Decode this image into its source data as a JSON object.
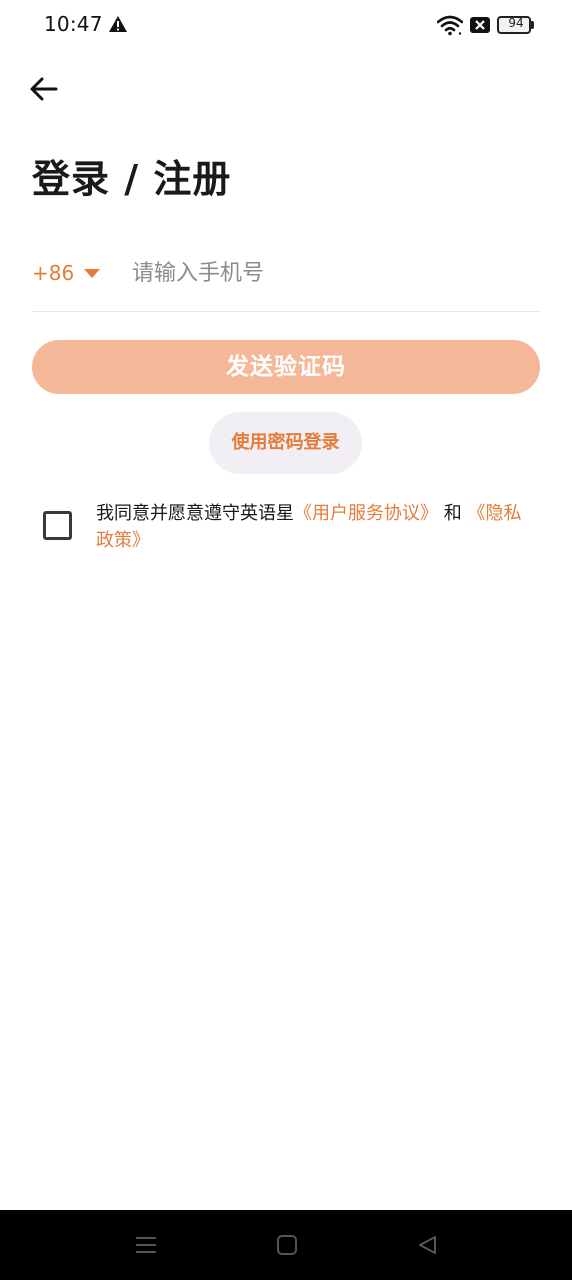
{
  "status_bar": {
    "time": "10:47",
    "battery_level": "94",
    "icons": [
      "warning-icon",
      "wifi-icon",
      "no-sim-icon",
      "battery-icon"
    ]
  },
  "header": {
    "back_icon": "arrow-left-icon",
    "title": "登录 / 注册"
  },
  "phone": {
    "country_code": "+86",
    "placeholder": "请输入手机号",
    "value": ""
  },
  "actions": {
    "send_code_label": "发送验证码",
    "password_login_label": "使用密码登录"
  },
  "agreement": {
    "checked": false,
    "prefix": "我同意并愿意遵守英语星",
    "user_agreement": "《用户服务协议》",
    "conjunction": "和",
    "privacy_policy": "《隐私政策》"
  },
  "nav_bar": {
    "icons": [
      "menu-icon",
      "home-icon",
      "back-triangle-icon"
    ]
  },
  "colors": {
    "accent": "#e57c3a",
    "button_disabled": "#f4b898",
    "pill_bg": "#f1eff4",
    "nav_bg": "#000000"
  }
}
